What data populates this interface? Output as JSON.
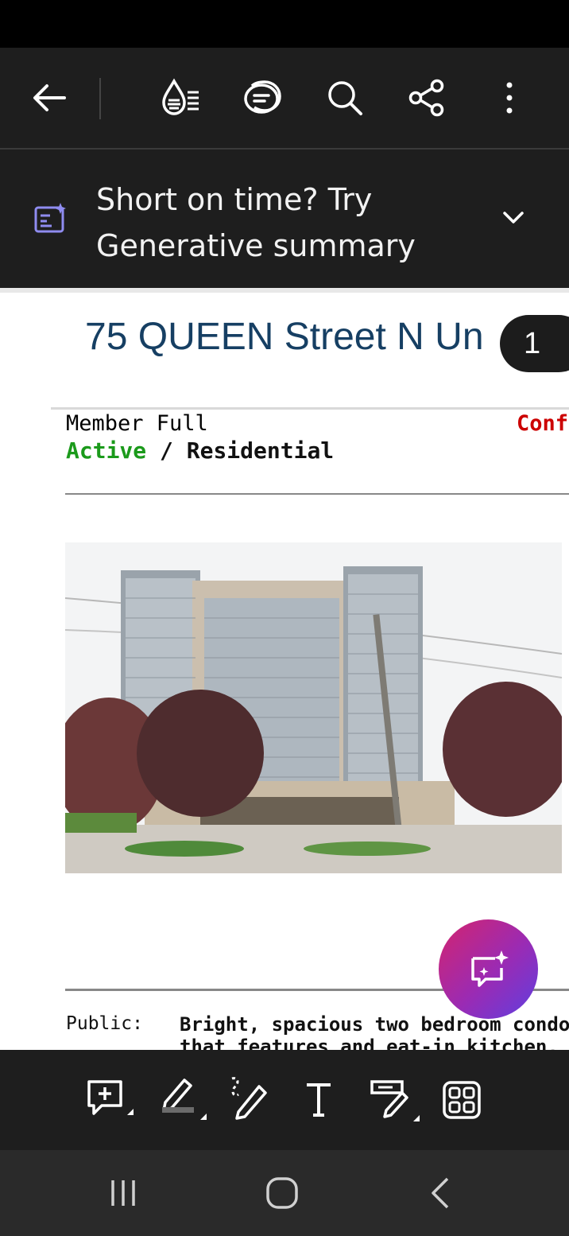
{
  "toolbar": {
    "back_icon": "arrow-left-icon",
    "liquid_mode_icon": "liquid-mode-icon",
    "comments_icon": "comments-icon",
    "search_icon": "search-icon",
    "share_icon": "share-icon",
    "more_icon": "more-vertical-icon"
  },
  "summary_banner": {
    "line1": "Short on time? Try",
    "line2": "Generative summary",
    "icon": "ai-summary-icon",
    "chevron": "chevron-down-icon"
  },
  "document": {
    "title": "75 QUEEN Street N Un",
    "page_number": "1",
    "member_full": "Member Full",
    "conf": "Conf",
    "status_active": "Active",
    "status_sep": "/",
    "status_type": "Residential",
    "public_label": "Public:",
    "description_line1": "Bright, spacious two bedroom condo i",
    "description_line2": "that features and eat-in kitchen, in su"
  },
  "ai_assistant": {
    "icon": "ai-assistant-icon"
  },
  "bottom_toolbar": {
    "items": [
      "add-comment-icon",
      "highlight-icon",
      "draw-icon",
      "text-icon",
      "fill-sign-icon",
      "all-tools-icon"
    ]
  },
  "nav_bar": {
    "items": [
      "recent-apps-icon",
      "home-icon",
      "back-nav-icon"
    ]
  },
  "colors": {
    "toolbar_bg": "#1e1e1e",
    "title_blue": "#163f63",
    "active_green": "#1b9a1b",
    "conf_red": "#cc0000",
    "summary_icon_purple": "#8f8cf0"
  }
}
